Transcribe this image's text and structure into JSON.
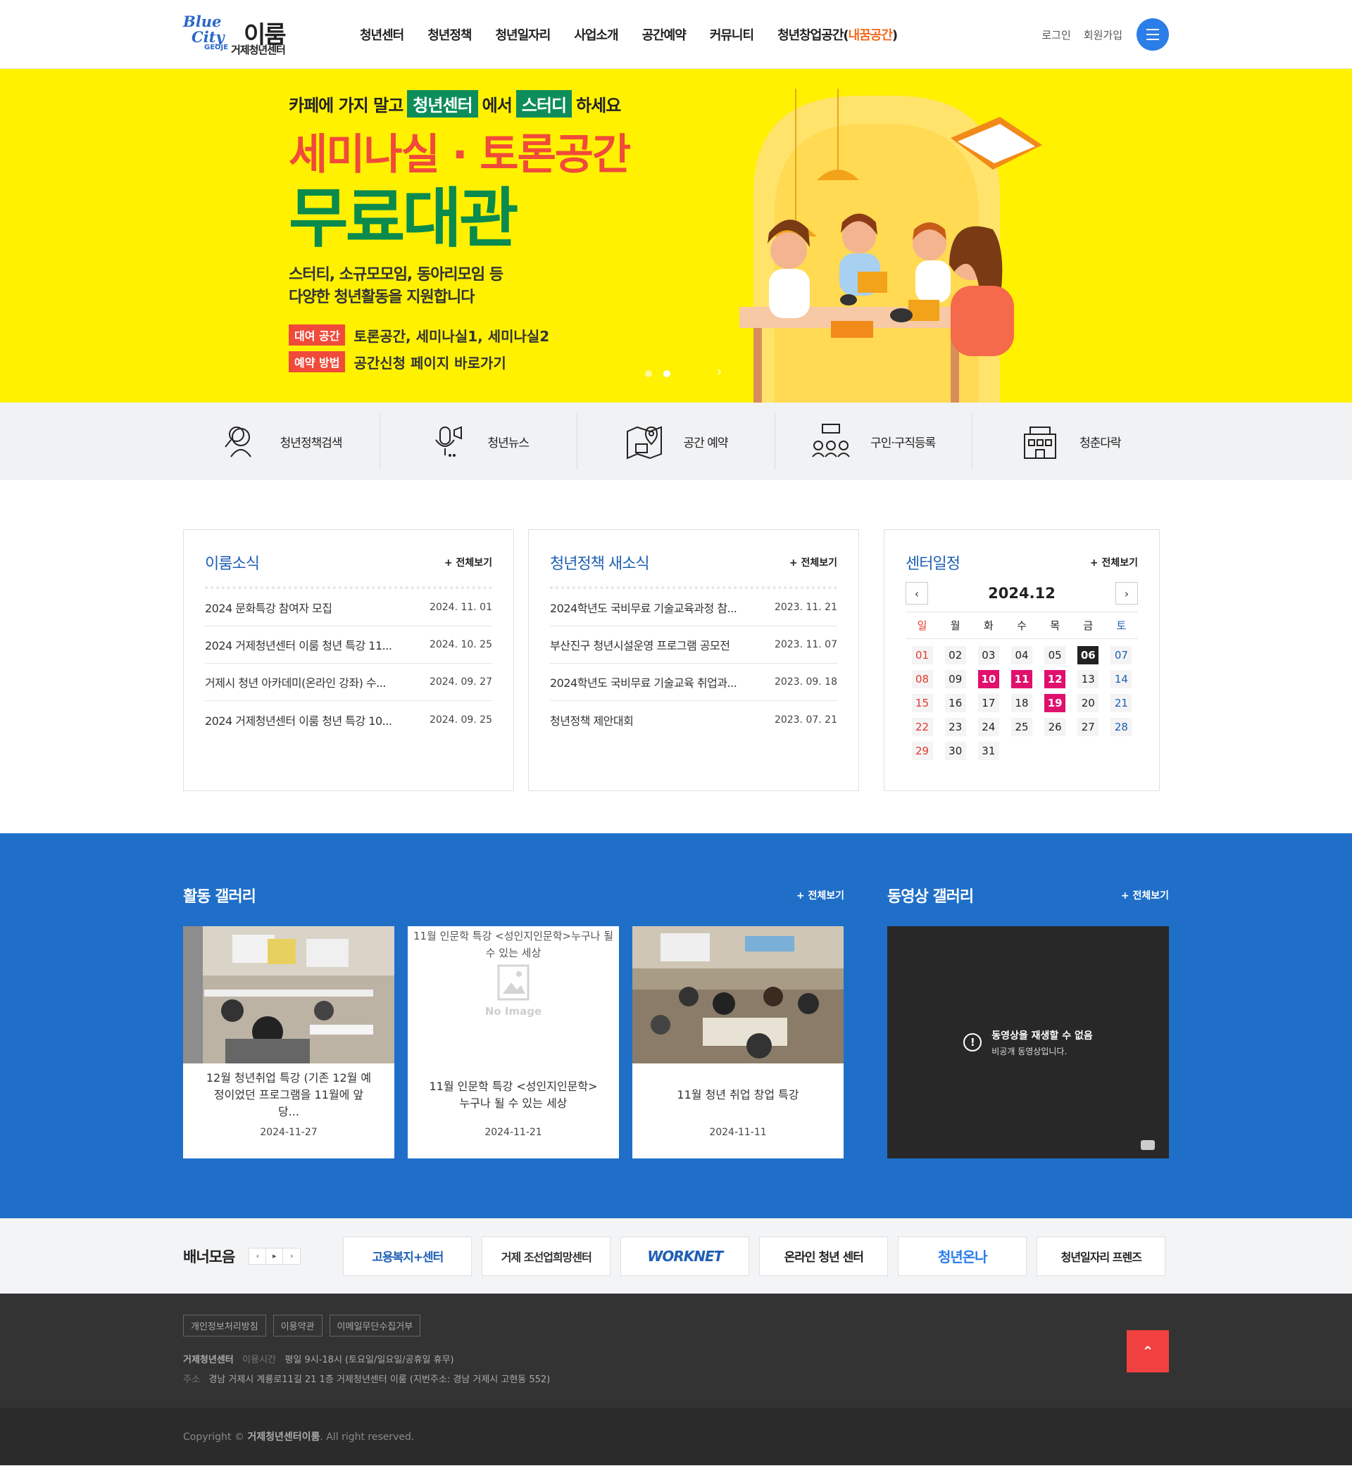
{
  "header": {
    "logo": {
      "blue": "Blue",
      "city": "City",
      "geoje": "GEOJE",
      "name": "이룸",
      "sub": "거제청년센터"
    },
    "nav": [
      "청년센터",
      "청년정책",
      "청년일자리",
      "사업소개",
      "공간예약",
      "커뮤니티"
    ],
    "nav_last": "청년창업공간(",
    "nav_last_hl": "내꿈공간",
    "nav_last_end": ")",
    "login": "로그인",
    "join": "회원가입"
  },
  "hero": {
    "top1": "카페에 가지 말고",
    "tag1": "청년센터",
    "top2": "에서",
    "tag2": "스터디",
    "top3": "하세요",
    "title1": "세미나실 · 토론공간",
    "title2": "무료대관",
    "desc1": "스터티, 소규모모임, 동아리모임 등",
    "desc2": "다양한 청년활동을 지원합니다",
    "row1_label": "대여 공간",
    "row1_text": "토론공간, 세미나실1, 세미나실2",
    "row2_label": "예약 방법",
    "row2_text": "공간신청 페이지 바로가기",
    "next": "›"
  },
  "quick": [
    {
      "label": "청년정책검색",
      "icon": "search-person-icon"
    },
    {
      "label": "청년뉴스",
      "icon": "microphone-icon"
    },
    {
      "label": "공간 예약",
      "icon": "map-pin-icon"
    },
    {
      "label": "구인·구직등록",
      "icon": "job-people-icon"
    },
    {
      "label": "청춘다락",
      "icon": "building-icon"
    }
  ],
  "more_label": "전체보기",
  "news": {
    "title": "이룸소식",
    "items": [
      {
        "t": "2024 문화특강 참여자 모집",
        "d": "2024. 11. 01"
      },
      {
        "t": "2024 거제청년센터 이룸 청년 특강 11...",
        "d": "2024. 10. 25"
      },
      {
        "t": "거제시 청년 아카데미(온라인 강좌) 수...",
        "d": "2024. 09. 27"
      },
      {
        "t": "2024 거제청년센터 이룸 청년 특강 10...",
        "d": "2024. 09. 25"
      }
    ]
  },
  "policy": {
    "title": "청년정책 새소식",
    "items": [
      {
        "t": "2024학년도 국비무료 기술교육과정 참...",
        "d": "2023. 11. 21"
      },
      {
        "t": "부산진구 청년시설운영 프로그램 공모전",
        "d": "2023. 11. 07"
      },
      {
        "t": "2024학년도 국비무료 기술교육 취업과...",
        "d": "2023. 09. 18"
      },
      {
        "t": "청년정책 제안대회",
        "d": "2023. 07. 21"
      }
    ]
  },
  "calendar": {
    "title": "센터일정",
    "month": "2024.12",
    "prev": "‹",
    "next": "›",
    "weekdays": [
      "일",
      "월",
      "화",
      "수",
      "목",
      "금",
      "토"
    ],
    "days": [
      "01",
      "02",
      "03",
      "04",
      "05",
      "06",
      "07",
      "08",
      "09",
      "10",
      "11",
      "12",
      "13",
      "14",
      "15",
      "16",
      "17",
      "18",
      "19",
      "20",
      "21",
      "22",
      "23",
      "24",
      "25",
      "26",
      "27",
      "28",
      "29",
      "30",
      "31"
    ],
    "event_days": [
      "10",
      "11",
      "12",
      "19"
    ],
    "today": "06"
  },
  "gallery": {
    "title": "활동 갤러리",
    "items": [
      {
        "caption": "12월 청년취업 특강 (기존 12월 예정이었던 프로그램을 11월에 앞당...",
        "date": "2024-11-27",
        "image": "photo"
      },
      {
        "caption": "11월 인문학 특강 <성인지인문학> 누구나 될 수 있는 세상",
        "date": "2024-11-21",
        "image": "none",
        "alt": "11월 인문학 특강 <성인지인문학>누구나 될 수 있는 세상",
        "placeholder": "No Image"
      },
      {
        "caption": "11월 청년 취업 창업 특강",
        "date": "2024-11-11",
        "image": "photo"
      }
    ]
  },
  "video": {
    "title": "동영상 갤러리",
    "msg1": "동영상을 재생할 수 없음",
    "msg2": "비공개 동영상입니다.",
    "icon": "alert-circle-icon"
  },
  "banners": {
    "title": "배너모음",
    "controls": [
      "‹",
      "▸",
      "›"
    ],
    "items": [
      "고용복지+센터",
      "거제 조선업희망센터",
      "WORKNET",
      "온라인 청년 센터",
      "청년온나",
      "청년일자리 프렌즈"
    ]
  },
  "footer": {
    "links": [
      "개인정보처리방침",
      "이용약관",
      "이메일무단수집거부"
    ],
    "org": "거제청년센터",
    "hours_label": "이용시간",
    "hours": "평일 9시-18시 (토요일/일요일/공휴일 휴무)",
    "addr_label": "주소",
    "addr": "경남 거제시 계룡로11길 21 1층 거제청년센터 이룸 (지번주소: 경남 거제시 고현동 552)",
    "top": "⌃",
    "copy_pre": "Copyright ©",
    "copy_name": "거제청년센터이룸",
    "copy_post": ". All right reserved."
  },
  "colors": {
    "accent": "#2b7de8",
    "hero_bg": "#fff100",
    "green": "#0a8a4d",
    "red": "#f04a3a",
    "event": "#e0106d",
    "gallery_bg": "#1f6fc9"
  }
}
